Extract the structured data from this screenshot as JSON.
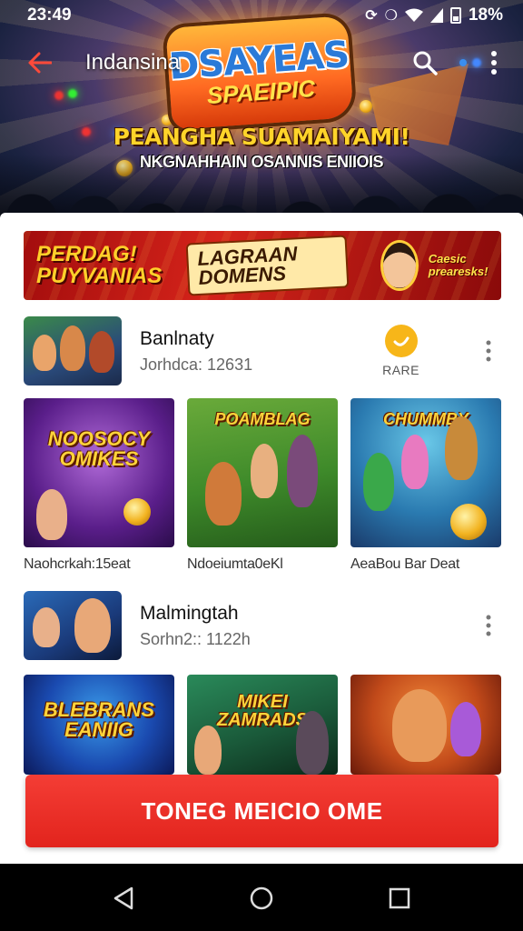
{
  "status_bar": {
    "time": "23:49",
    "battery_text": "18%",
    "signal_glyph": "⁶"
  },
  "app_bar": {
    "title": "Indansina",
    "back_icon": "back-arrow-icon",
    "search_icon": "search-icon",
    "menu_icon": "more-vert-icon",
    "accent_dot": "#3a8ef0"
  },
  "hero": {
    "logo_title": "DSAYEAS",
    "logo_sub": "SPAEIPIC",
    "headline": "PEANGHA SUAMAIYAMI!",
    "subline": "NKGNAHHAIN OSANNIS ENIIOIS"
  },
  "promo_banner": {
    "left_text": "PERDAG! PUYVANIAS",
    "mid_text": "LAGRAAN DOMENS",
    "right_text": "Caesic prearesks!"
  },
  "app_rows": [
    {
      "name": "Banlnaty",
      "meta": "Jorhdca: 12631",
      "badge_text": "RARE",
      "badge_icon": "clock-icon",
      "has_badge": true
    },
    {
      "name": "Malmingtah",
      "meta": "Sorhn2:: 1122h",
      "has_badge": false
    }
  ],
  "cards_row1": [
    {
      "title": "Naohcrkah:15eat",
      "art_word": "NOOSOCY OMIKES"
    },
    {
      "title": "Ndoeiumta0eKl",
      "art_word": "POAMBLAG"
    },
    {
      "title": "AeaBou Bar Deat",
      "art_word": "CHUMMBY"
    }
  ],
  "cards_row2": [
    {
      "art_word": "BLEBRANS EANIIG"
    },
    {
      "art_word": "MIKEI ZAMRADS"
    },
    {
      "art_word": ""
    }
  ],
  "cta": {
    "label": "TONEG MEICIO OME"
  },
  "nav": {
    "back": "nav-back-icon",
    "home": "nav-home-icon",
    "recents": "nav-recents-icon"
  },
  "colors": {
    "cta": "#e9271f",
    "badge": "#f7b619",
    "banner": "#c41a14"
  }
}
